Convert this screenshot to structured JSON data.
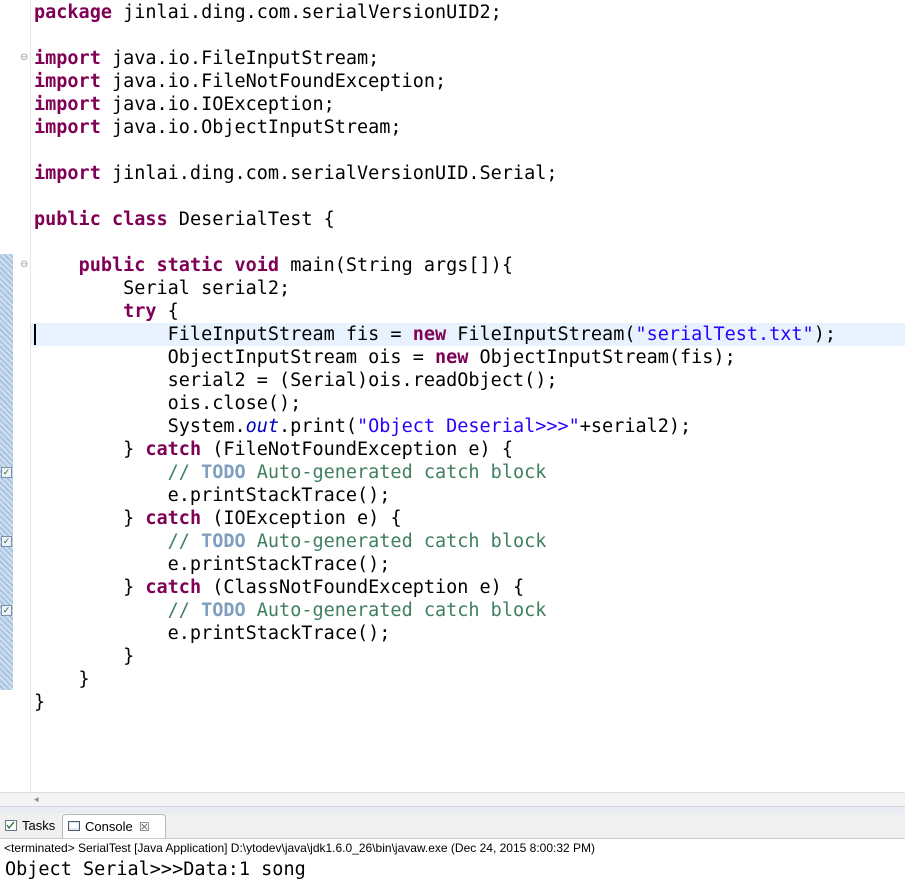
{
  "editor": {
    "lines": [
      {
        "segments": [
          {
            "t": "package",
            "c": "kw"
          },
          {
            "t": " jinlai.ding.com.serialVersionUID2;"
          }
        ]
      },
      {
        "segments": []
      },
      {
        "segments": [
          {
            "t": "import",
            "c": "kw"
          },
          {
            "t": " java.io.FileInputStream;"
          }
        ],
        "fold": true
      },
      {
        "segments": [
          {
            "t": "import",
            "c": "kw"
          },
          {
            "t": " java.io.FileNotFoundException;"
          }
        ]
      },
      {
        "segments": [
          {
            "t": "import",
            "c": "kw"
          },
          {
            "t": " java.io.IOException;"
          }
        ]
      },
      {
        "segments": [
          {
            "t": "import",
            "c": "kw"
          },
          {
            "t": " java.io.ObjectInputStream;"
          }
        ]
      },
      {
        "segments": []
      },
      {
        "segments": [
          {
            "t": "import",
            "c": "kw"
          },
          {
            "t": " jinlai.ding.com.serialVersionUID.Serial;"
          }
        ]
      },
      {
        "segments": []
      },
      {
        "segments": [
          {
            "t": "public",
            "c": "kw"
          },
          {
            "t": " "
          },
          {
            "t": "class",
            "c": "kw"
          },
          {
            "t": " DeserialTest {"
          }
        ]
      },
      {
        "segments": []
      },
      {
        "segments": [
          {
            "t": "    "
          },
          {
            "t": "public",
            "c": "kw"
          },
          {
            "t": " "
          },
          {
            "t": "static",
            "c": "kw"
          },
          {
            "t": " "
          },
          {
            "t": "void",
            "c": "kw"
          },
          {
            "t": " main(String args[]){"
          }
        ],
        "fold": true
      },
      {
        "segments": [
          {
            "t": "        Serial serial2;"
          }
        ]
      },
      {
        "segments": [
          {
            "t": "        "
          },
          {
            "t": "try",
            "c": "kw"
          },
          {
            "t": " {"
          }
        ]
      },
      {
        "segments": [
          {
            "t": "            FileInputStream fis = "
          },
          {
            "t": "new",
            "c": "kw"
          },
          {
            "t": " FileInputStream("
          },
          {
            "t": "\"serialTest.txt\"",
            "c": "str"
          },
          {
            "t": ");"
          }
        ]
      },
      {
        "segments": [
          {
            "t": "            ObjectInputStream ois = "
          },
          {
            "t": "new",
            "c": "kw"
          },
          {
            "t": " ObjectInputStream(fis);"
          }
        ]
      },
      {
        "segments": [
          {
            "t": "            serial2 = (Serial)ois.readObject();"
          }
        ]
      },
      {
        "segments": [
          {
            "t": "            ois.close();"
          }
        ]
      },
      {
        "segments": [
          {
            "t": "            System."
          },
          {
            "t": "out",
            "c": "italic"
          },
          {
            "t": ".print("
          },
          {
            "t": "\"Object Deserial>>>\"",
            "c": "str"
          },
          {
            "t": "+serial2);"
          }
        ]
      },
      {
        "segments": [
          {
            "t": "        } "
          },
          {
            "t": "catch",
            "c": "kw"
          },
          {
            "t": " (FileNotFoundException e) {"
          }
        ]
      },
      {
        "segments": [
          {
            "t": "            "
          },
          {
            "t": "// ",
            "c": "com"
          },
          {
            "t": "TODO",
            "c": "todo"
          },
          {
            "t": " Auto-generated catch block",
            "c": "com"
          }
        ],
        "task": true
      },
      {
        "segments": [
          {
            "t": "            e.printStackTrace();"
          }
        ]
      },
      {
        "segments": [
          {
            "t": "        } "
          },
          {
            "t": "catch",
            "c": "kw"
          },
          {
            "t": " (IOException e) {"
          }
        ]
      },
      {
        "segments": [
          {
            "t": "            "
          },
          {
            "t": "// ",
            "c": "com"
          },
          {
            "t": "TODO",
            "c": "todo"
          },
          {
            "t": " Auto-generated catch block",
            "c": "com"
          }
        ],
        "task": true
      },
      {
        "segments": [
          {
            "t": "            e.printStackTrace();"
          }
        ]
      },
      {
        "segments": [
          {
            "t": "        } "
          },
          {
            "t": "catch",
            "c": "kw"
          },
          {
            "t": " (ClassNotFoundException e) {"
          }
        ]
      },
      {
        "segments": [
          {
            "t": "            "
          },
          {
            "t": "// ",
            "c": "com"
          },
          {
            "t": "TODO",
            "c": "todo"
          },
          {
            "t": " Auto-generated catch block",
            "c": "com"
          }
        ],
        "task": true
      },
      {
        "segments": [
          {
            "t": "            e.printStackTrace();"
          }
        ]
      },
      {
        "segments": [
          {
            "t": "        }"
          }
        ]
      },
      {
        "segments": [
          {
            "t": "    }"
          }
        ]
      },
      {
        "segments": [
          {
            "t": "}"
          }
        ]
      }
    ]
  },
  "bottom_panel": {
    "tabs": [
      {
        "label": "Tasks"
      },
      {
        "label": "Console"
      }
    ],
    "close_glyph": "☒",
    "console_header": "<terminated> SerialTest [Java Application] D:\\ytodev\\java\\jdk1.6.0_26\\bin\\javaw.exe (Dec 24, 2015 8:00:32 PM)",
    "console_output": "Object Serial>>>Data:1 song"
  },
  "colors": {
    "keyword": "#7f0055",
    "string": "#2a00ff",
    "comment": "#3f7f5f",
    "todo": "#7f9fbf",
    "current_line": "#e8f2fe"
  }
}
